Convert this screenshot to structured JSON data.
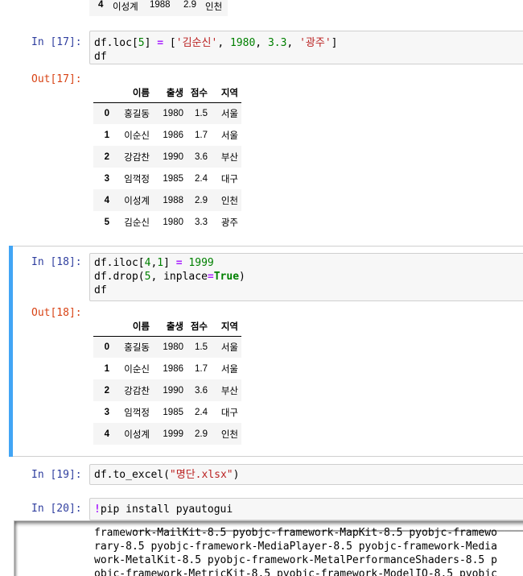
{
  "top_row": {
    "index": "4",
    "name": "이성계",
    "year": "1988",
    "score": "2.9",
    "region": "인천"
  },
  "cells": [
    {
      "in_prompt": "In [17]:",
      "out_prompt": "Out[17]:",
      "code": {
        "line1": {
          "a": "df.loc[",
          "b": "5",
          "c": "] ",
          "d": "=",
          "e": " [",
          "f": "'김순신'",
          "g": ", ",
          "h": "1980",
          "i": ", ",
          "j": "3.3",
          "k": ", ",
          "l": "'광주'",
          "m": "]"
        },
        "line2": "df"
      },
      "table": {
        "columns": [
          "이름",
          "출생",
          "점수",
          "지역"
        ],
        "rows": [
          [
            "0",
            "홍길동",
            "1980",
            "1.5",
            "서울"
          ],
          [
            "1",
            "이순신",
            "1986",
            "1.7",
            "서울"
          ],
          [
            "2",
            "강감찬",
            "1990",
            "3.6",
            "부산"
          ],
          [
            "3",
            "임꺽정",
            "1985",
            "2.4",
            "대구"
          ],
          [
            "4",
            "이성계",
            "1988",
            "2.9",
            "인천"
          ],
          [
            "5",
            "김순신",
            "1980",
            "3.3",
            "광주"
          ]
        ]
      }
    },
    {
      "in_prompt": "In [18]:",
      "out_prompt": "Out[18]:",
      "code": {
        "line1": {
          "a": "df.iloc[",
          "b": "4",
          "c": ",",
          "d": "1",
          "e": "] ",
          "f": "=",
          "g": " ",
          "h": "1999"
        },
        "line2": {
          "a": "df.drop(",
          "b": "5",
          "c": ", inplace",
          "d": "=",
          "e": "True",
          "f": ")"
        },
        "line3": "df"
      },
      "table": {
        "columns": [
          "이름",
          "출생",
          "점수",
          "지역"
        ],
        "rows": [
          [
            "0",
            "홍길동",
            "1980",
            "1.5",
            "서울"
          ],
          [
            "1",
            "이순신",
            "1986",
            "1.7",
            "서울"
          ],
          [
            "2",
            "강감찬",
            "1990",
            "3.6",
            "부산"
          ],
          [
            "3",
            "임꺽정",
            "1985",
            "2.4",
            "대구"
          ],
          [
            "4",
            "이성계",
            "1999",
            "2.9",
            "인천"
          ]
        ]
      }
    },
    {
      "in_prompt": "In [19]:",
      "code": {
        "a": "df.to_excel(",
        "b": "\"명단.xlsx\"",
        "c": ")"
      }
    },
    {
      "in_prompt": "In [20]:",
      "code": {
        "bang": "!",
        "rest": "pip install pyautogui"
      },
      "output_lines": [
        "framework-MailKit-8.5 pyobjc-framework-MapKit-8.5 pyobjc-framewo",
        "rary-8.5 pyobjc-framework-MediaPlayer-8.5 pyobjc-framework-Media",
        "work-MetalKit-8.5 pyobjc-framework-MetalPerformanceShaders-8.5 p",
        "objc-framework-MetricKit-8.5 pyobjc-framework-ModelIO-8.5 pyobjc"
      ]
    }
  ]
}
